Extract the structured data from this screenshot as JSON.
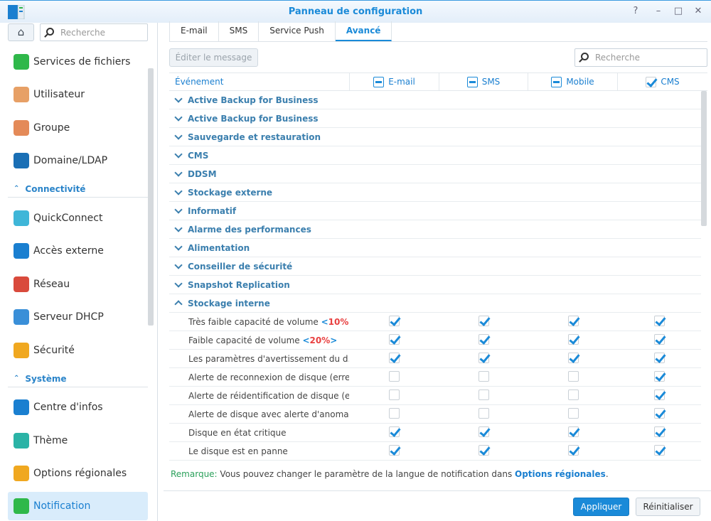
{
  "window": {
    "title": "Panneau de configuration",
    "help": "?",
    "minimize": "–",
    "maximize": "□",
    "close": "✕"
  },
  "sidebar": {
    "search_placeholder": "Recherche",
    "items": [
      {
        "label": "Services de fichiers",
        "icon": "file-services-icon",
        "color": "#2fb84a"
      },
      {
        "label": "Utilisateur",
        "icon": "user-icon",
        "color": "#e7a066"
      },
      {
        "label": "Groupe",
        "icon": "group-icon",
        "color": "#e48a58"
      },
      {
        "label": "Domaine/LDAP",
        "icon": "domain-icon",
        "color": "#1a6fb5"
      },
      {
        "label": "QuickConnect",
        "icon": "quickconnect-icon",
        "color": "#3fb6d8"
      },
      {
        "label": "Accès externe",
        "icon": "globe-icon",
        "color": "#1a7fd0"
      },
      {
        "label": "Réseau",
        "icon": "network-house-icon",
        "color": "#d94a3c"
      },
      {
        "label": "Serveur DHCP",
        "icon": "dhcp-icon",
        "color": "#3a8fd8"
      },
      {
        "label": "Sécurité",
        "icon": "shield-icon",
        "color": "#f0a820"
      },
      {
        "label": "Centre d'infos",
        "icon": "info-icon",
        "color": "#1a7fd0"
      },
      {
        "label": "Thème",
        "icon": "palette-icon",
        "color": "#2bb3a6"
      },
      {
        "label": "Options régionales",
        "icon": "regional-icon",
        "color": "#f0a820"
      },
      {
        "label": "Notification",
        "icon": "chat-icon",
        "color": "#2fb84a"
      }
    ],
    "sections": [
      "Connectivité",
      "Système"
    ]
  },
  "tabs": [
    "E-mail",
    "SMS",
    "Service Push",
    "Avancé"
  ],
  "active_tab": "Avancé",
  "toolbar": {
    "edit_label": "Éditer le message",
    "search_placeholder": "Recherche"
  },
  "table": {
    "headers": [
      "Événement",
      "E-mail",
      "SMS",
      "Mobile",
      "CMS"
    ],
    "header_states": [
      "partial",
      "partial",
      "partial",
      "checked"
    ],
    "groups": [
      "Active Backup for Business",
      "Active Backup for Business",
      "Sauvegarde et restauration",
      "CMS",
      "DDSM",
      "Stockage externe",
      "Informatif",
      "Alarme des performances",
      "Alimentation",
      "Conseiller de sécurité",
      "Snapshot Replication"
    ],
    "expanded_group": "Stockage interne",
    "rows": [
      {
        "event": "Très faible capacité de volume ",
        "threshold": "10%",
        "checks": [
          true,
          true,
          true,
          true
        ]
      },
      {
        "event": "Faible capacité de volume ",
        "threshold": "20%",
        "checks": [
          true,
          true,
          true,
          true
        ]
      },
      {
        "event": "Les paramètres d'avertissement du d...",
        "checks": [
          true,
          true,
          true,
          true
        ]
      },
      {
        "event": "Alerte de reconnexion de disque (erre...",
        "checks": [
          false,
          false,
          false,
          true
        ]
      },
      {
        "event": "Alerte de réidentification de disque (e...",
        "checks": [
          false,
          false,
          false,
          true
        ]
      },
      {
        "event": "Alerte de disque avec alerte d'anomal...",
        "checks": [
          false,
          false,
          false,
          true
        ]
      },
      {
        "event": "Disque en état critique",
        "checks": [
          true,
          true,
          true,
          true
        ]
      },
      {
        "event": "Le disque est en panne",
        "checks": [
          true,
          true,
          true,
          true
        ]
      }
    ]
  },
  "remark": {
    "key": "Remarque:",
    "text": " Vous pouvez changer le paramètre de la langue de notification dans ",
    "link": "Options régionales",
    "end": "."
  },
  "footer": {
    "apply": "Appliquer",
    "reset": "Réinitialiser"
  },
  "colors": {
    "accent": "#1a8ad8",
    "threshold": "#e84040",
    "remark": "#2aa05a"
  }
}
